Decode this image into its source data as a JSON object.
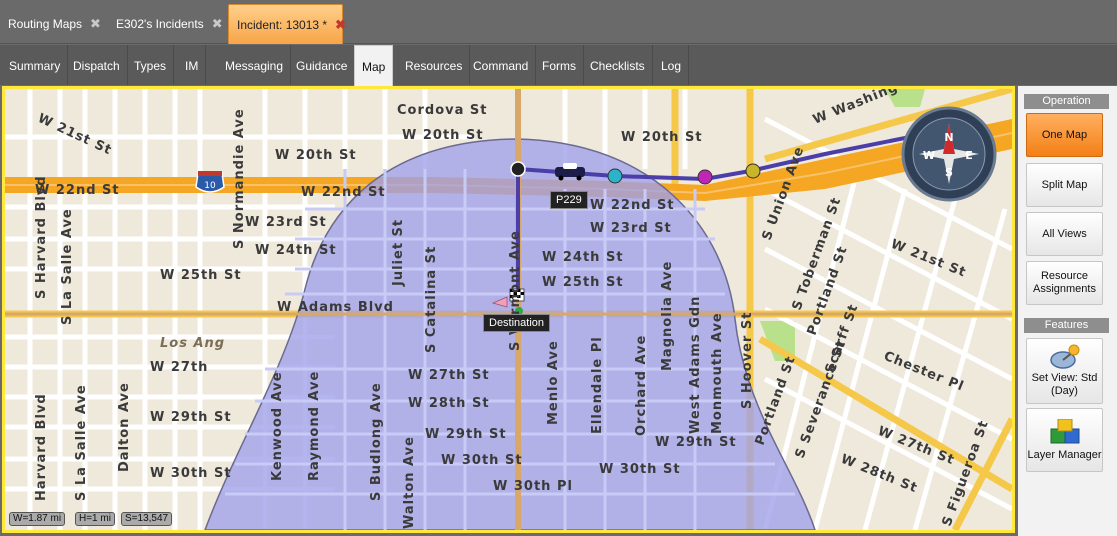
{
  "doc_tabs": [
    {
      "label": "Routing Maps"
    },
    {
      "label": "E302's Incidents"
    },
    {
      "label": "Incident: 13013 *"
    }
  ],
  "close_glyph": "✖",
  "sub_tabs": [
    "Summary",
    "Dispatch",
    "Types",
    "IM",
    "Messaging",
    "Guidance",
    "Map",
    "Resources",
    "Command",
    "Forms",
    "Checklists",
    "Log"
  ],
  "active_sub_tab": "Map",
  "map": {
    "streets": {
      "cordova": "Cordova St",
      "w21_tl": "W 21st St",
      "w20_a": "W 20th St",
      "w20_b": "W 20th St",
      "w20_c": "W 20th St",
      "w22_a": "W 22nd St",
      "w22_b": "W 22nd St",
      "w22_c": "W 22nd St",
      "w23_a": "W 23rd St",
      "w23_b": "W 23rd St",
      "w24_a": "W 24th St",
      "w24_b": "W 24th St",
      "w25_a": "W 25th St",
      "w25_b": "W 25th St",
      "adams": "W Adams Blvd",
      "w27_a": "W 27th",
      "w27_b": "W 27th St",
      "w27_c": "W 27th St",
      "w28_a": "W 28th St",
      "w28_b": "W 28th St",
      "w29_a": "W 29th St",
      "w29_b": "W 29th St",
      "w29_c": "W 29th St",
      "w30_a": "W 30th St",
      "w30_b": "W 30th St",
      "w30_c": "W 30th St",
      "w30pl": "W 30th Pl",
      "w21_r": "W 21st St",
      "chester": "Chester Pl",
      "washington": "W Washington",
      "harvard_a": "S Harvard Blvd",
      "harvard_b": "Harvard Blvd",
      "lasalle_a": "S La Salle Ave",
      "lasalle_b": "S La Salle Ave",
      "normandie": "S Normandie Ave",
      "dalton": "Dalton Ave",
      "kenwood": "Kenwood Ave",
      "raymond": "Raymond Ave",
      "budlong": "S Budlong Ave",
      "walton": "Walton Ave",
      "juliet": "Juliet St",
      "catalina": "S Catalina St",
      "vermont": "S Vermont Ave",
      "menlo": "Menlo Ave",
      "ellendale": "Ellendale Pl",
      "orchard": "Orchard Ave",
      "magnolia": "Magnolia Ave",
      "westadams": "West Adams Gdn",
      "monmouth": "Monmouth Ave",
      "hoover": "S Hoover St",
      "union": "S Union Ave",
      "toberman": "S Toberman St",
      "portland_a": "Portland St",
      "portland_b": "Portland St",
      "scarff": "Scarff St",
      "severance": "S Severance St",
      "figueroa": "S Figueroa St",
      "losang": "Los Ang"
    },
    "highway_shield": "10",
    "unit_label": "P229",
    "destination_label": "Destination",
    "compass": {
      "n": "N",
      "s": "S",
      "e": "E",
      "w": "W"
    },
    "scale": {
      "w": "W=1.87 mi",
      "h": "H=1 mi",
      "s": "S=13,547"
    },
    "colors": {
      "highway": "#f5a623",
      "zone": "#9fa0ea",
      "route": "#4b3ea8"
    }
  },
  "side_panel": {
    "operation_header": "Operation",
    "one_map": "One Map",
    "split_map": "Split Map",
    "all_views": "All Views",
    "resource_assign": "Resource Assignments",
    "features_header": "Features",
    "set_view": "Set View: Std (Day)",
    "layer_manager": "Layer Manager",
    "active_button": "One Map"
  }
}
